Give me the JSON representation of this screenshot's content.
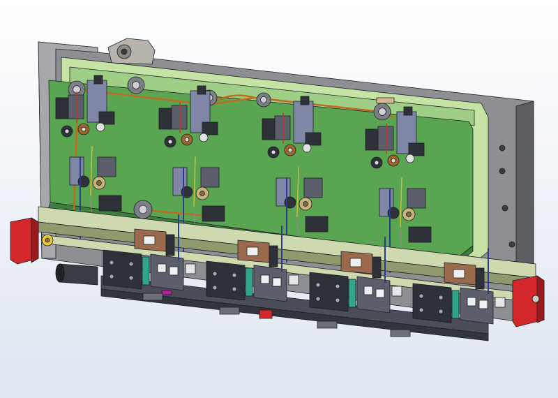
{
  "viewport": {
    "background": {
      "top": "#ffffff",
      "bottom": "#dfe6f0"
    }
  },
  "colors": {
    "back_plate": "#8e8f93",
    "back_plate_edge": "#5d5e63",
    "frame_light": "#c6e3a6",
    "frame_mid": "#9fcf86",
    "board_green": "#5aa552",
    "board_dark": "#3f7f3d",
    "rail": "#cfd9b0",
    "rail_dark": "#8f9a6e",
    "steel_dark": "#2e3138",
    "steel": "#5c5f6b",
    "steel_light": "#9ca0ad",
    "blue_steel": "#7f86a6",
    "belt": "#c06a1e",
    "copper": "#a0652a",
    "brown_block": "#9b6a4c",
    "red_end": "#d2282c",
    "teal": "#2fa58a",
    "magenta": "#c21c9d",
    "yellow": "#e6c83a",
    "wire_blue": "#2a3a8f",
    "wire_red": "#c0392b",
    "wire_yellow": "#cdbf3a"
  },
  "assembly": {
    "module_count": 4
  }
}
